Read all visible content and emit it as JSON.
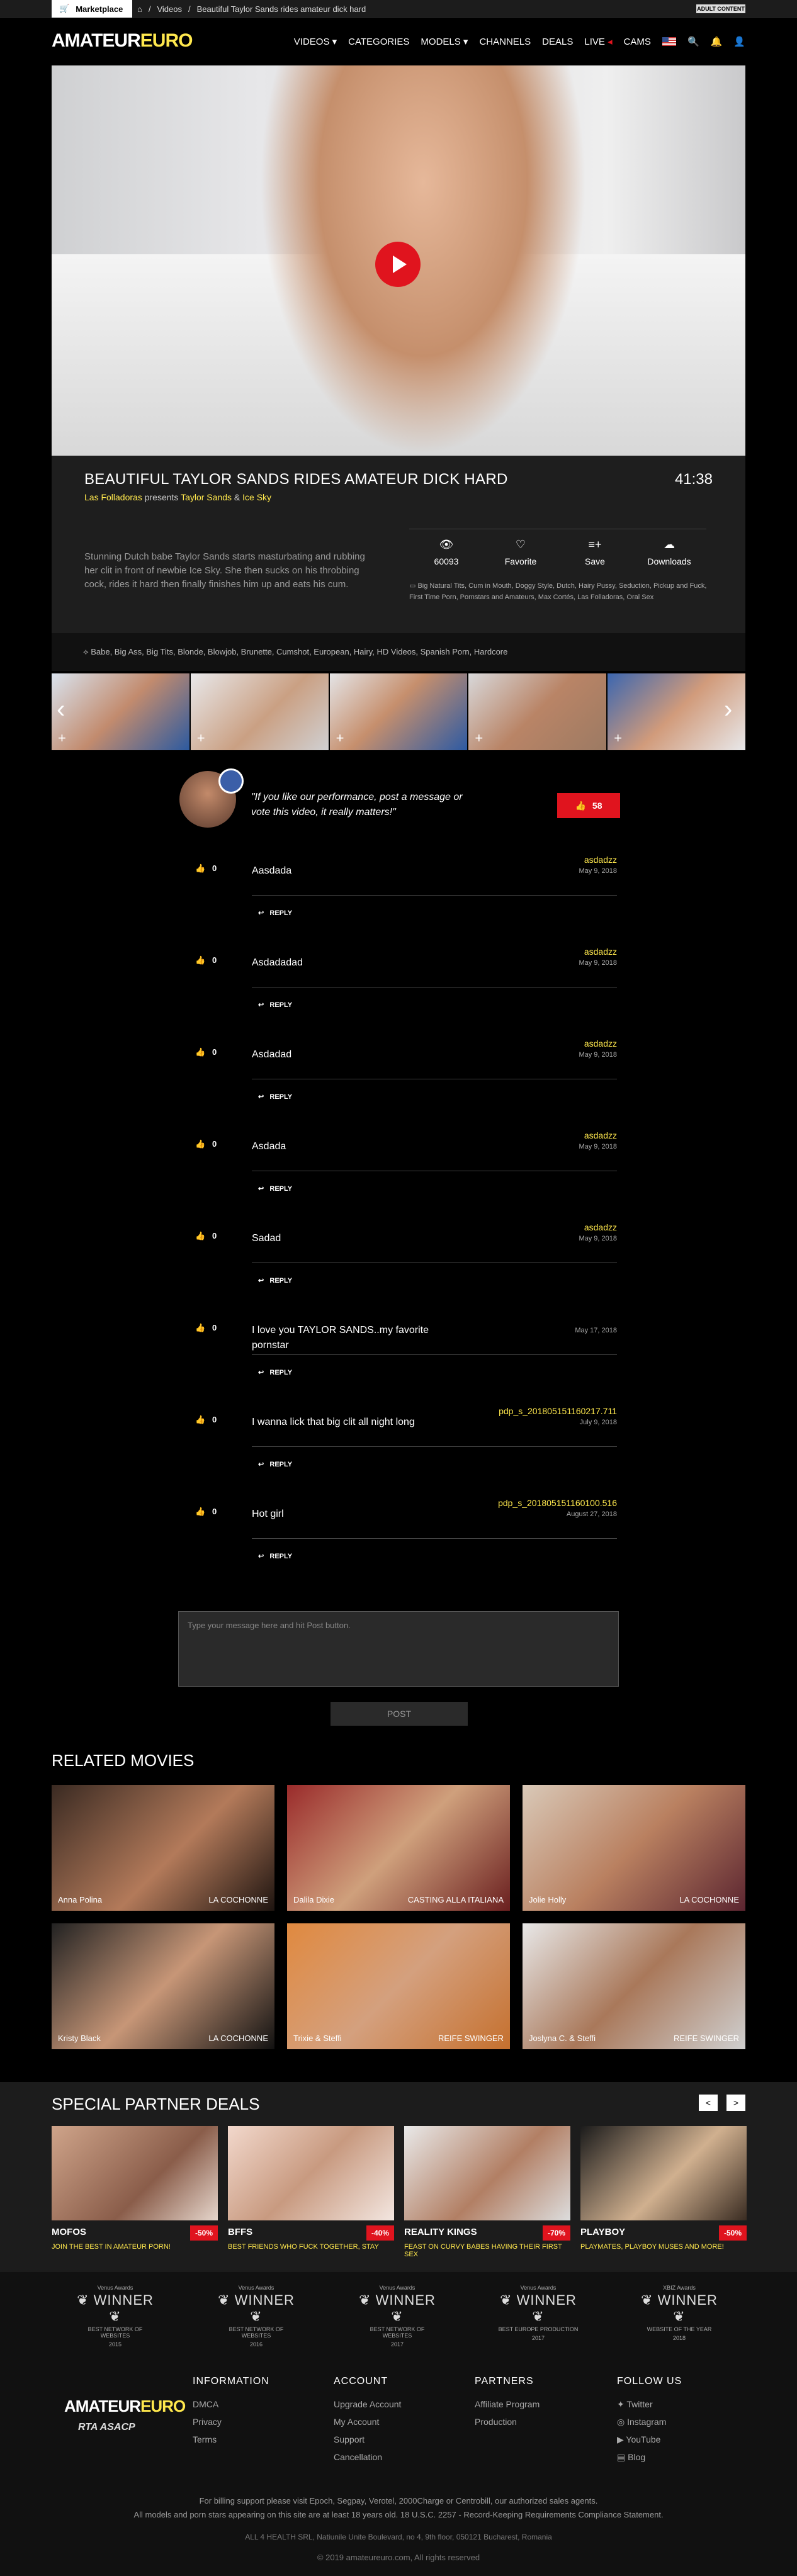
{
  "topbar": {
    "marketplace": "Marketplace",
    "crumbs": [
      "Videos",
      "Beautiful Taylor Sands rides amateur dick hard"
    ],
    "badge": "ADULT CONTENT"
  },
  "logo": {
    "part1": "AMATEUR",
    "part2": "EURO",
    "accent": "#ffe84d"
  },
  "nav": [
    "VIDEOS",
    "CATEGORIES",
    "MODELS",
    "CHANNELS",
    "DEALS",
    "LIVE",
    "CAMS"
  ],
  "video": {
    "title": "Beautiful Taylor Sands rides amateur dick hard",
    "duration": "41:38",
    "studio": "Las Folladoras",
    "presents": "presents",
    "actor1": "Taylor Sands",
    "amp": "&",
    "actor2": "Ice Sky",
    "description": "Stunning Dutch babe Taylor Sands starts masturbating and rubbing her clit in front of newbie Ice Sky. She then sucks on his throbbing cock, rides it hard then finally finishes him up and eats his cum.",
    "actions": [
      {
        "icon": "eye-icon",
        "label": "60093"
      },
      {
        "icon": "heart-icon",
        "label": "Favorite"
      },
      {
        "icon": "playlist-add-icon",
        "label": "Save"
      },
      {
        "icon": "cloud-download-icon",
        "label": "Downloads"
      }
    ],
    "categories": "Big Natural Tits,  Cum in Mouth,  Doggy Style,  Dutch,  Hairy Pussy,  Seduction,  Pickup and Fuck,  First Time Porn,  Pornstars and Amateurs,  Max Cortés,  Las Folladoras,  Oral Sex",
    "tags": "Babe,  Big Ass,  Big Tits,  Blonde,  Blowjob,  Brunette,  Cumshot,  European,  Hairy,  HD Videos,  Spanish Porn,  Hardcore"
  },
  "cta": {
    "quote": "\"If you like our performance, post a message or vote this video, it really matters!\"",
    "likes": "58"
  },
  "comments": [
    {
      "likes": "0",
      "text": "Aasdada",
      "user": "asdadzz",
      "date": "May 9, 2018",
      "reply": "REPLY"
    },
    {
      "likes": "0",
      "text": "Asdadadad",
      "user": "asdadzz",
      "date": "May 9, 2018",
      "reply": "REPLY"
    },
    {
      "likes": "0",
      "text": "Asdadad",
      "user": "asdadzz",
      "date": "May 9, 2018",
      "reply": "REPLY"
    },
    {
      "likes": "0",
      "text": "Asdada",
      "user": "asdadzz",
      "date": "May 9, 2018",
      "reply": "REPLY"
    },
    {
      "likes": "0",
      "text": "Sadad",
      "user": "asdadzz",
      "date": "May 9, 2018",
      "reply": "REPLY"
    },
    {
      "likes": "0",
      "text": "I love you TAYLOR SANDS..my favorite pornstar",
      "user": "",
      "date": "May 17, 2018",
      "reply": "REPLY"
    },
    {
      "likes": "0",
      "text": "I wanna lick that big clit all night long",
      "user": "pdp_s_201805151160217.711",
      "date": "July 9, 2018",
      "reply": "REPLY"
    },
    {
      "likes": "0",
      "text": "Hot girl",
      "user": "pdp_s_201805151160100.516",
      "date": "August 27, 2018",
      "reply": "REPLY"
    }
  ],
  "message": {
    "placeholder": "Type your message here and hit Post button.",
    "post": "POST"
  },
  "related": {
    "title": "RELATED MOVIES",
    "items": [
      {
        "name": "Anna Polina",
        "studio": "LA COCHONNE"
      },
      {
        "name": "Dalila Dixie",
        "studio": "CASTING ALLA ITALIANA"
      },
      {
        "name": "Jolie Holly",
        "studio": "LA COCHONNE"
      },
      {
        "name": "Kristy Black",
        "studio": "LA COCHONNE"
      },
      {
        "name": "Trixie & Steffi",
        "studio": "REIFE SWINGER"
      },
      {
        "name": "Joslyna C. & Steffi",
        "studio": "REIFE SWINGER"
      }
    ]
  },
  "partners": {
    "title": "SPECIAL PARTNER DEALS",
    "prev": "<",
    "next": ">",
    "deals": [
      {
        "name": "MOFOS",
        "pct": "-50%",
        "sub": "JOIN THE BEST IN AMATEUR PORN!"
      },
      {
        "name": "BFFS",
        "pct": "-40%",
        "sub": "BEST FRIENDS WHO FUCK TOGETHER, STAY"
      },
      {
        "name": "REALITY KINGS",
        "pct": "-70%",
        "sub": "FEAST ON CURVY BABES HAVING THEIR FIRST SEX"
      },
      {
        "name": "PLAYBOY",
        "pct": "-50%",
        "sub": "PLAYMATES, PLAYBOY MUSES AND MORE!"
      }
    ]
  },
  "awards": [
    {
      "top": "Venus Awards",
      "word": "WINNER",
      "sub": "BEST NETWORK OF WEBSITES",
      "year": "2015"
    },
    {
      "top": "Venus Awards",
      "word": "WINNER",
      "sub": "BEST NETWORK OF WEBSITES",
      "year": "2016"
    },
    {
      "top": "Venus Awards",
      "word": "WINNER",
      "sub": "BEST NETWORK OF WEBSITES",
      "year": "2017"
    },
    {
      "top": "Venus Awards",
      "word": "WINNER",
      "sub": "BEST EUROPE PRODUCTION",
      "year": "2017"
    },
    {
      "top": "XBIZ Awards",
      "word": "WINNER",
      "sub": "WEBSITE OF THE YEAR",
      "year": "2018"
    }
  ],
  "footer": {
    "logo1": "AMATEUR",
    "logo2": "EURO",
    "badges": "RTA  ASACP",
    "information": {
      "h": "INFORMATION",
      "items": [
        "DMCA",
        "Privacy",
        "Terms"
      ]
    },
    "account": {
      "h": "ACCOUNT",
      "items": [
        "Upgrade Account",
        "My Account",
        "Support",
        "Cancellation"
      ]
    },
    "partners": {
      "h": "PARTNERS",
      "items": [
        "Affiliate Program",
        "Production"
      ]
    },
    "follow": {
      "h": "FOLLOW US",
      "items": [
        "Twitter",
        "Instagram",
        "YouTube",
        "Blog"
      ]
    },
    "billing": "For billing support please visit Epoch, Segpay, Verotel, 2000Charge or Centrobill, our authorized sales agents.",
    "compliance": "All models and porn stars appearing on this site are at least 18 years old. 18 U.S.C. 2257 - Record-Keeping Requirements Compliance Statement.",
    "address": "ALL 4 HEALTH SRL, Natiunile Unite Boulevard, no 4, 9th floor, 050121 Bucharest, Romania",
    "copyright": "© 2019 amateureuro.com, All rights reserved"
  }
}
